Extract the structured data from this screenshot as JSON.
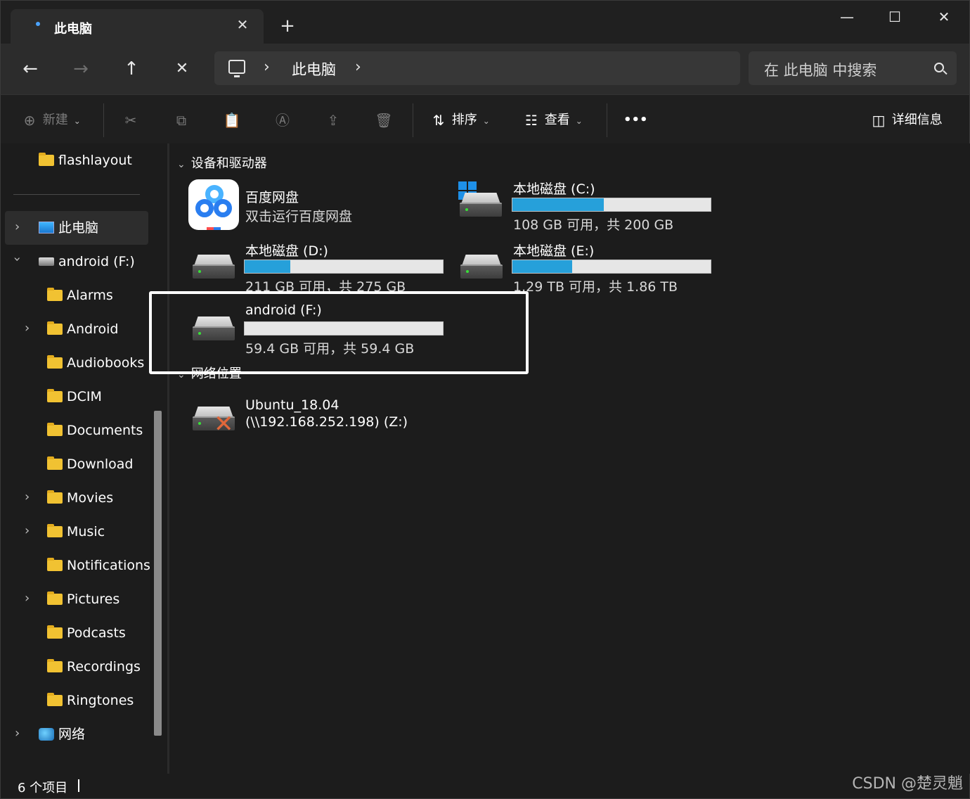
{
  "tab": {
    "title": "此电脑",
    "close": "✕",
    "new_tab": "+"
  },
  "window_controls": {
    "minimize": "—",
    "maximize": "☐",
    "close": "✕"
  },
  "nav": {
    "back": "←",
    "forward": "→",
    "up": "↑",
    "stop": "✕"
  },
  "address": {
    "chevron1": "›",
    "location": "此电脑",
    "chevron2": "›"
  },
  "search": {
    "placeholder": "在 此电脑 中搜索"
  },
  "commands": {
    "new": "新建",
    "sort": "排序",
    "view": "查看",
    "more": "•••",
    "details": "详细信息"
  },
  "sidebar": {
    "pinned": "flashlayout",
    "this_pc": "此电脑",
    "drive": "android (F:)",
    "folders": [
      "Alarms",
      "Android",
      "Audiobooks",
      "DCIM",
      "Documents",
      "Download",
      "Movies",
      "Music",
      "Notifications",
      "Pictures",
      "Podcasts",
      "Recordings",
      "Ringtones"
    ],
    "network": "网络"
  },
  "main": {
    "devices_header": "设备和驱动器",
    "network_header": "网络位置",
    "baidu": {
      "name": "百度网盘",
      "sub": "双击运行百度网盘"
    },
    "drive_c": {
      "name": "本地磁盘 (C:)",
      "free": "108 GB 可用，共 200 GB",
      "used_fraction": 0.46
    },
    "drive_d": {
      "name": "本地磁盘 (D:)",
      "free": "211 GB 可用，共 275 GB",
      "used_fraction": 0.23
    },
    "drive_e": {
      "name": "本地磁盘 (E:)",
      "free": "1.29 TB 可用，共 1.86 TB",
      "used_fraction": 0.3
    },
    "drive_f": {
      "name": "android (F:)",
      "free": "59.4 GB 可用，共 59.4 GB",
      "used_fraction": 0.0
    },
    "ubuntu": {
      "name": "Ubuntu_18.04",
      "path": "(\\\\192.168.252.198) (Z:)"
    }
  },
  "status": {
    "count": "6 个项目"
  },
  "watermark": "CSDN @楚灵魈"
}
